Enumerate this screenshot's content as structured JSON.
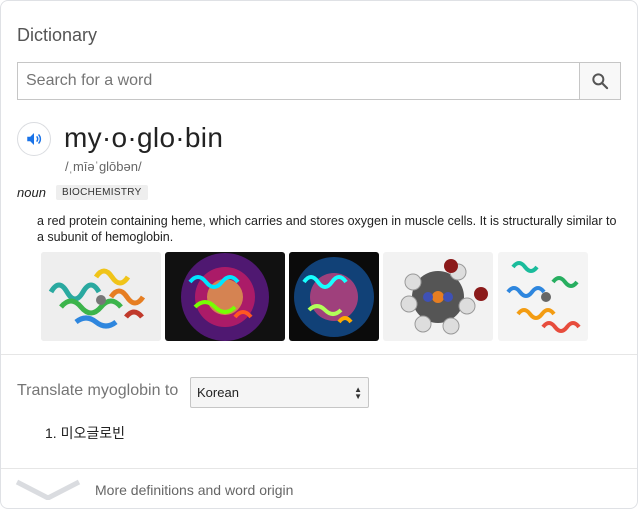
{
  "panel": {
    "title": "Dictionary"
  },
  "search": {
    "placeholder": "Search for a word",
    "icon": "search-icon"
  },
  "entry": {
    "word": "my·o·glo·bin",
    "phonetic": "/ˌmīəˈɡlōbən/",
    "part_of_speech": "noun",
    "domain_tag": "BIOCHEMISTRY",
    "definition": "a red protein containing heme, which carries and stores oxygen in muscle cells. It is structurally similar to a subunit of hemoglobin.",
    "images": [
      {
        "name": "myoglobin-ribbon-image-1",
        "bg": "#eeeeee"
      },
      {
        "name": "myoglobin-ribbon-image-2",
        "bg": "#111111"
      },
      {
        "name": "myoglobin-ribbon-image-3",
        "bg": "#0b0b0b"
      },
      {
        "name": "heme-spacefill-image",
        "bg": "#f2f2f2"
      },
      {
        "name": "myoglobin-ribbon-image-5",
        "bg": "#f4f4f4"
      }
    ]
  },
  "translate": {
    "label": "Translate myoglobin to",
    "selected_language": "Korean",
    "result_number": "1.",
    "result_text": "미오글로빈"
  },
  "footer": {
    "more_label": "More definitions and word origin"
  },
  "colors": {
    "accent": "#1a73e8",
    "muted": "#757575",
    "divider": "#e6e6e6"
  }
}
